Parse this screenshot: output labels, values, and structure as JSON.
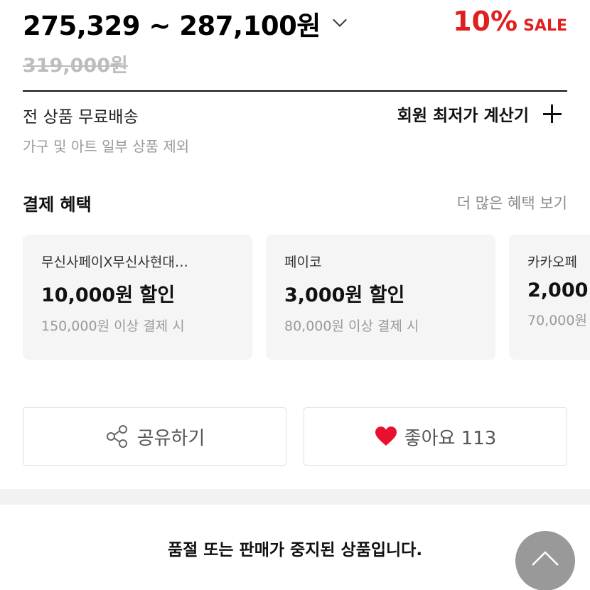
{
  "price": {
    "range": "275,329 ~ 287,100원",
    "original": "319,000원",
    "discount_percent": "10%",
    "sale_label": "SALE"
  },
  "shipping": {
    "title": "전 상품 무료배송",
    "note": "가구 및 아트 일부 상품 제외",
    "calc_label": "회원 최저가 계산기"
  },
  "benefits": {
    "title": "결제 혜택",
    "more_label": "더 많은 혜택 보기",
    "cards": [
      {
        "name": "무신사페이X무신사현대…",
        "amount": "10,000원 할인",
        "condition": "150,000원 이상 결제 시"
      },
      {
        "name": "페이코",
        "amount": "3,000원 할인",
        "condition": "80,000원 이상 결제 시"
      },
      {
        "name": "카카오페",
        "amount": "2,000",
        "condition": "70,000원"
      }
    ]
  },
  "actions": {
    "share_label": "공유하기",
    "like_label": "좋아요 113"
  },
  "status": {
    "soldout_message": "품절 또는 판매가 중지된 상품입니다."
  },
  "colors": {
    "sale_red": "#e02020",
    "heart_red": "#e8112d",
    "scroll_button": "#999999"
  },
  "icons": {
    "range_toggle": "chevron-down-icon",
    "calc": "plus-icon",
    "share": "share-icon",
    "like": "heart-icon",
    "scroll_top": "chevron-up-icon"
  }
}
